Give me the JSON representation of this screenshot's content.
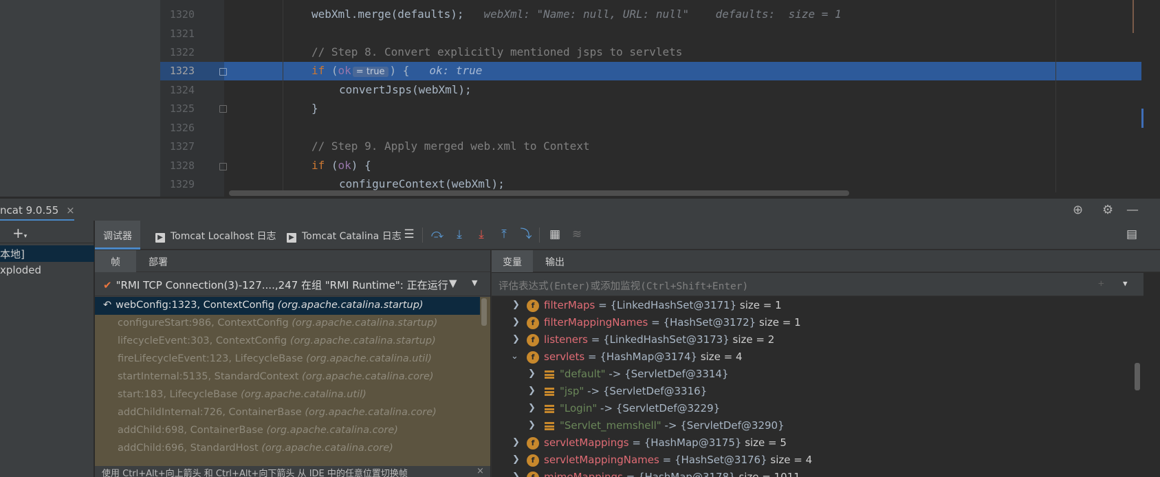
{
  "editor": {
    "lines": [
      {
        "num": "1320",
        "code": "webXml.merge(defaults);",
        "hint": "webXml: \"Name: null, URL: null\"    defaults:  size = 1"
      },
      {
        "num": "1321",
        "code": "",
        "hint": ""
      },
      {
        "num": "1322",
        "code": "// Step 8. Convert explicitly mentioned jsps to servlets",
        "hint": ""
      },
      {
        "num": "1323",
        "kw": "if",
        "pre": " (",
        "var": "ok",
        "inlay": "= true",
        "post": ") {",
        "hint": "ok: true"
      },
      {
        "num": "1324",
        "code": "convertJsps(webXml);",
        "hint": ""
      },
      {
        "num": "1325",
        "code": "}",
        "hint": ""
      },
      {
        "num": "1326",
        "code": "",
        "hint": ""
      },
      {
        "num": "1327",
        "code": "// Step 9. Apply merged web.xml to Context",
        "hint": ""
      },
      {
        "num": "1328",
        "kw": "if",
        "pre": " (",
        "var": "ok",
        "post": ") {",
        "hint": ""
      },
      {
        "num": "1329",
        "code": "configureContext(webXml);",
        "hint": ""
      }
    ]
  },
  "run_tab": {
    "label": "ncat 9.0.55",
    "close": "×"
  },
  "services": {
    "add": "+",
    "local": "本地]",
    "exploded": "xploded"
  },
  "debugger_toolbar": {
    "tab_debugger": "调试器",
    "tab_localhost": "Tomcat Localhost 日志",
    "tab_catalina": "Tomcat Catalina 日志"
  },
  "frames": {
    "tab_frames": "帧",
    "tab_deploy": "部署",
    "thread": "\"RMI TCP Connection(3)-127....,247 在组 \"RMI Runtime\": 正在运行",
    "items": [
      {
        "method": "webConfig:1323, ContextConfig",
        "pkg": "(org.apache.catalina.startup)"
      },
      {
        "method": "configureStart:986, ContextConfig",
        "pkg": "(org.apache.catalina.startup)"
      },
      {
        "method": "lifecycleEvent:303, ContextConfig",
        "pkg": "(org.apache.catalina.startup)"
      },
      {
        "method": "fireLifecycleEvent:123, LifecycleBase",
        "pkg": "(org.apache.catalina.util)"
      },
      {
        "method": "startInternal:5135, StandardContext",
        "pkg": "(org.apache.catalina.core)"
      },
      {
        "method": "start:183, LifecycleBase",
        "pkg": "(org.apache.catalina.util)"
      },
      {
        "method": "addChildInternal:726, ContainerBase",
        "pkg": "(org.apache.catalina.core)"
      },
      {
        "method": "addChild:698, ContainerBase",
        "pkg": "(org.apache.catalina.core)"
      },
      {
        "method": "addChild:696, StandardHost",
        "pkg": "(org.apache.catalina.core)"
      }
    ],
    "tip": "使用 Ctrl+Alt+向上箭头 和 Ctrl+Alt+向下箭头 从 IDE 中的任意位置切换帧"
  },
  "variables": {
    "tab_vars": "变量",
    "tab_output": "输出",
    "eval_placeholder": "评估表达式(Enter)或添加监视(Ctrl+Shift+Enter)",
    "items": [
      {
        "name": "filterMaps",
        "type": "{LinkedHashSet@3171}",
        "size": "size = 1"
      },
      {
        "name": "filterMappingNames",
        "type": "{HashSet@3172}",
        "size": "size = 1"
      },
      {
        "name": "listeners",
        "type": "{LinkedHashSet@3173}",
        "size": "size = 2"
      },
      {
        "name": "servlets",
        "type": "{HashMap@3174}",
        "size": "size = 4"
      },
      {
        "key": "\"default\"",
        "val": "-> {ServletDef@3314}"
      },
      {
        "key": "\"jsp\"",
        "val": "-> {ServletDef@3316}"
      },
      {
        "key": "\"Login\"",
        "val": "-> {ServletDef@3229}"
      },
      {
        "key": "\"Servlet_memshell\"",
        "val": "-> {ServletDef@3290}"
      },
      {
        "name": "servletMappings",
        "type": "{HashMap@3175}",
        "size": "size = 5"
      },
      {
        "name": "servletMappingNames",
        "type": "{HashSet@3176}",
        "size": "size = 4"
      },
      {
        "name": "mimeMappings",
        "type": "{HashMap@3178}",
        "size": "size = 1011"
      }
    ]
  }
}
